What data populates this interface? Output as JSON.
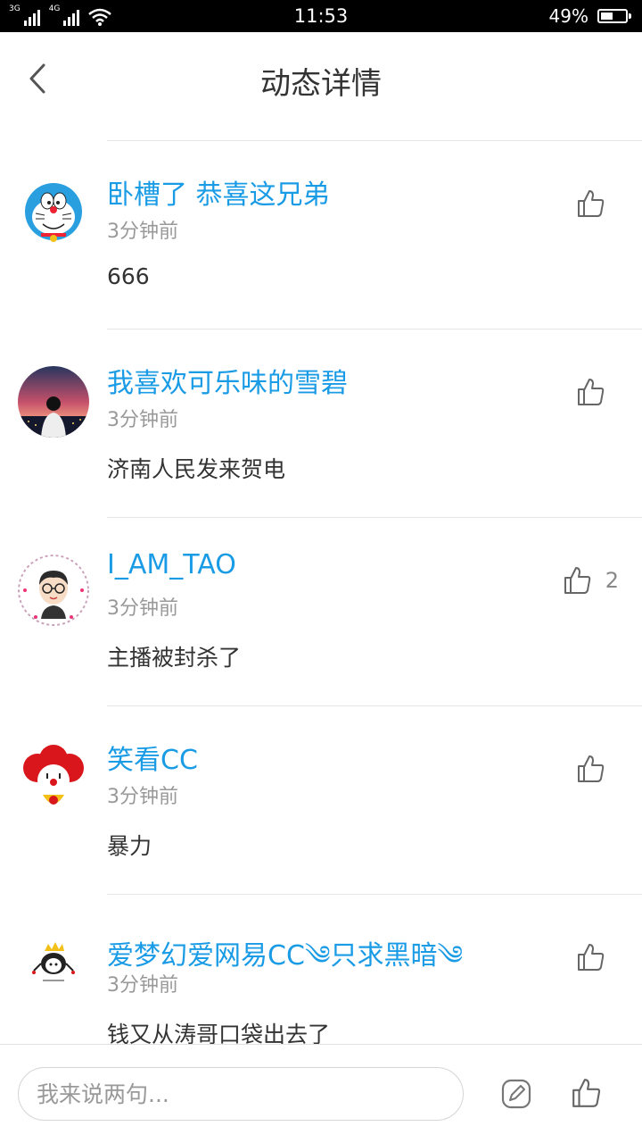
{
  "status_bar": {
    "network_1": "3G",
    "network_2": "4G",
    "time": "11:53",
    "battery_percent": "49%",
    "battery_level": 0.49
  },
  "header": {
    "title": "动态详情"
  },
  "comments": [
    {
      "username": "卧槽了 恭喜这兄弟",
      "time": "3分钟前",
      "text": "666",
      "likes": ""
    },
    {
      "username": "我喜欢可乐味的雪碧",
      "time": "3分钟前",
      "text": "济南人民发来贺电",
      "likes": ""
    },
    {
      "username": "I_AM_TAO",
      "time": "3分钟前",
      "text": "主播被封杀了",
      "likes": "2"
    },
    {
      "username": "笑看CC",
      "time": "3分钟前",
      "text": "暴力",
      "likes": ""
    },
    {
      "username": "爱梦幻爱网易CC༄只求黑暗༄",
      "time": "3分钟前",
      "text": "钱又从涛哥口袋出去了",
      "likes": ""
    }
  ],
  "input_bar": {
    "placeholder": "我来说两句..."
  },
  "colors": {
    "accent": "#1a9be6",
    "text": "#333333",
    "muted": "#999999"
  }
}
